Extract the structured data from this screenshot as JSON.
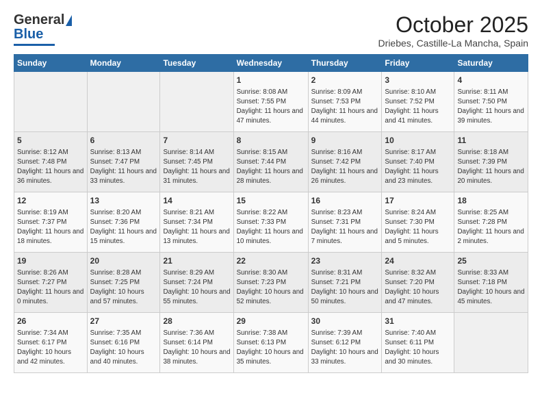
{
  "logo": {
    "general": "General",
    "blue": "Blue"
  },
  "header": {
    "title": "October 2025",
    "subtitle": "Driebes, Castille-La Mancha, Spain"
  },
  "weekdays": [
    "Sunday",
    "Monday",
    "Tuesday",
    "Wednesday",
    "Thursday",
    "Friday",
    "Saturday"
  ],
  "weeks": [
    [
      {
        "day": "",
        "info": ""
      },
      {
        "day": "",
        "info": ""
      },
      {
        "day": "",
        "info": ""
      },
      {
        "day": "1",
        "info": "Sunrise: 8:08 AM\nSunset: 7:55 PM\nDaylight: 11 hours and 47 minutes."
      },
      {
        "day": "2",
        "info": "Sunrise: 8:09 AM\nSunset: 7:53 PM\nDaylight: 11 hours and 44 minutes."
      },
      {
        "day": "3",
        "info": "Sunrise: 8:10 AM\nSunset: 7:52 PM\nDaylight: 11 hours and 41 minutes."
      },
      {
        "day": "4",
        "info": "Sunrise: 8:11 AM\nSunset: 7:50 PM\nDaylight: 11 hours and 39 minutes."
      }
    ],
    [
      {
        "day": "5",
        "info": "Sunrise: 8:12 AM\nSunset: 7:48 PM\nDaylight: 11 hours and 36 minutes."
      },
      {
        "day": "6",
        "info": "Sunrise: 8:13 AM\nSunset: 7:47 PM\nDaylight: 11 hours and 33 minutes."
      },
      {
        "day": "7",
        "info": "Sunrise: 8:14 AM\nSunset: 7:45 PM\nDaylight: 11 hours and 31 minutes."
      },
      {
        "day": "8",
        "info": "Sunrise: 8:15 AM\nSunset: 7:44 PM\nDaylight: 11 hours and 28 minutes."
      },
      {
        "day": "9",
        "info": "Sunrise: 8:16 AM\nSunset: 7:42 PM\nDaylight: 11 hours and 26 minutes."
      },
      {
        "day": "10",
        "info": "Sunrise: 8:17 AM\nSunset: 7:40 PM\nDaylight: 11 hours and 23 minutes."
      },
      {
        "day": "11",
        "info": "Sunrise: 8:18 AM\nSunset: 7:39 PM\nDaylight: 11 hours and 20 minutes."
      }
    ],
    [
      {
        "day": "12",
        "info": "Sunrise: 8:19 AM\nSunset: 7:37 PM\nDaylight: 11 hours and 18 minutes."
      },
      {
        "day": "13",
        "info": "Sunrise: 8:20 AM\nSunset: 7:36 PM\nDaylight: 11 hours and 15 minutes."
      },
      {
        "day": "14",
        "info": "Sunrise: 8:21 AM\nSunset: 7:34 PM\nDaylight: 11 hours and 13 minutes."
      },
      {
        "day": "15",
        "info": "Sunrise: 8:22 AM\nSunset: 7:33 PM\nDaylight: 11 hours and 10 minutes."
      },
      {
        "day": "16",
        "info": "Sunrise: 8:23 AM\nSunset: 7:31 PM\nDaylight: 11 hours and 7 minutes."
      },
      {
        "day": "17",
        "info": "Sunrise: 8:24 AM\nSunset: 7:30 PM\nDaylight: 11 hours and 5 minutes."
      },
      {
        "day": "18",
        "info": "Sunrise: 8:25 AM\nSunset: 7:28 PM\nDaylight: 11 hours and 2 minutes."
      }
    ],
    [
      {
        "day": "19",
        "info": "Sunrise: 8:26 AM\nSunset: 7:27 PM\nDaylight: 11 hours and 0 minutes."
      },
      {
        "day": "20",
        "info": "Sunrise: 8:28 AM\nSunset: 7:25 PM\nDaylight: 10 hours and 57 minutes."
      },
      {
        "day": "21",
        "info": "Sunrise: 8:29 AM\nSunset: 7:24 PM\nDaylight: 10 hours and 55 minutes."
      },
      {
        "day": "22",
        "info": "Sunrise: 8:30 AM\nSunset: 7:23 PM\nDaylight: 10 hours and 52 minutes."
      },
      {
        "day": "23",
        "info": "Sunrise: 8:31 AM\nSunset: 7:21 PM\nDaylight: 10 hours and 50 minutes."
      },
      {
        "day": "24",
        "info": "Sunrise: 8:32 AM\nSunset: 7:20 PM\nDaylight: 10 hours and 47 minutes."
      },
      {
        "day": "25",
        "info": "Sunrise: 8:33 AM\nSunset: 7:18 PM\nDaylight: 10 hours and 45 minutes."
      }
    ],
    [
      {
        "day": "26",
        "info": "Sunrise: 7:34 AM\nSunset: 6:17 PM\nDaylight: 10 hours and 42 minutes."
      },
      {
        "day": "27",
        "info": "Sunrise: 7:35 AM\nSunset: 6:16 PM\nDaylight: 10 hours and 40 minutes."
      },
      {
        "day": "28",
        "info": "Sunrise: 7:36 AM\nSunset: 6:14 PM\nDaylight: 10 hours and 38 minutes."
      },
      {
        "day": "29",
        "info": "Sunrise: 7:38 AM\nSunset: 6:13 PM\nDaylight: 10 hours and 35 minutes."
      },
      {
        "day": "30",
        "info": "Sunrise: 7:39 AM\nSunset: 6:12 PM\nDaylight: 10 hours and 33 minutes."
      },
      {
        "day": "31",
        "info": "Sunrise: 7:40 AM\nSunset: 6:11 PM\nDaylight: 10 hours and 30 minutes."
      },
      {
        "day": "",
        "info": ""
      }
    ]
  ]
}
